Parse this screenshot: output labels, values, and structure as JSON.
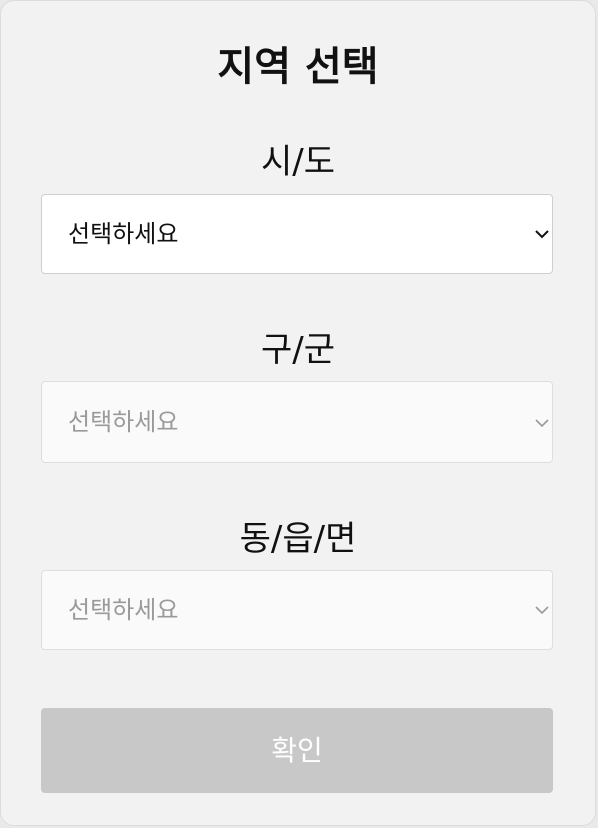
{
  "title": "지역 선택",
  "fields": [
    {
      "label": "시/도",
      "value": "선택하세요",
      "disabled": false
    },
    {
      "label": "구/군",
      "value": "선택하세요",
      "disabled": true
    },
    {
      "label": "동/읍/면",
      "value": "선택하세요",
      "disabled": true
    }
  ],
  "confirm_label": "확인",
  "colors": {
    "panel_bg": "#f2f2f2",
    "button_disabled_bg": "#c8c8c8",
    "placeholder_disabled": "#9a9a9a"
  },
  "icons": [
    "chevron-down-icon"
  ]
}
